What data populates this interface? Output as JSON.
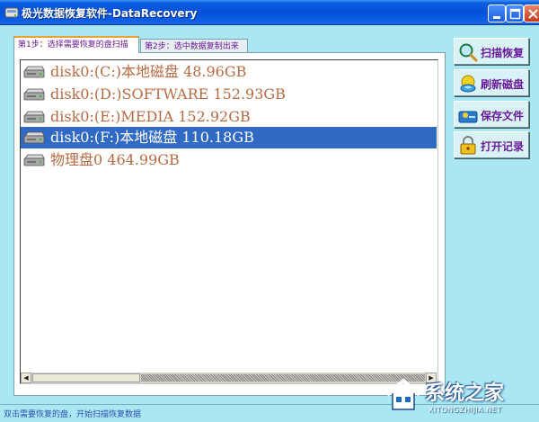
{
  "window": {
    "title": "极光数据恢复软件-DataRecovery"
  },
  "tabs": [
    {
      "label": "第1步：选择需要恢复的盘扫描",
      "active": true
    },
    {
      "label": "第2步：选中数据复制出来",
      "active": false
    }
  ],
  "disks": [
    {
      "label": "disk0:(C:)本地磁盘 48.96GB",
      "selected": false,
      "icon": "hard-disk-icon"
    },
    {
      "label": "disk0:(D:)SOFTWARE 152.93GB",
      "selected": false,
      "icon": "hard-disk-icon"
    },
    {
      "label": "disk0:(E:)MEDIA 152.92GB",
      "selected": false,
      "icon": "hard-disk-icon"
    },
    {
      "label": "disk0:(F:)本地磁盘 110.18GB",
      "selected": true,
      "icon": "hard-disk-icon"
    },
    {
      "label": "物理盘0 464.99GB",
      "selected": false,
      "icon": "hard-disk-icon"
    }
  ],
  "buttons": {
    "scan": {
      "label": "扫描恢复",
      "icon": "magnifier-icon"
    },
    "refresh": {
      "label": "刷新磁盘",
      "icon": "refresh-disk-icon"
    },
    "save": {
      "label": "保存文件",
      "icon": "save-file-icon"
    },
    "open": {
      "label": "打开记录",
      "icon": "open-record-icon"
    }
  },
  "status": {
    "text": "双击需要恢复的盘，开始扫描恢复数据"
  },
  "watermark": {
    "main": "系统之家",
    "sub": "XITONGZHIJIA.NET"
  },
  "colors": {
    "window_bg": "#a9e7f2",
    "titlebar": "#0550d8",
    "selection": "#316ac5",
    "disk_text": "#b86b43",
    "button_text": "#6a1a9a"
  }
}
